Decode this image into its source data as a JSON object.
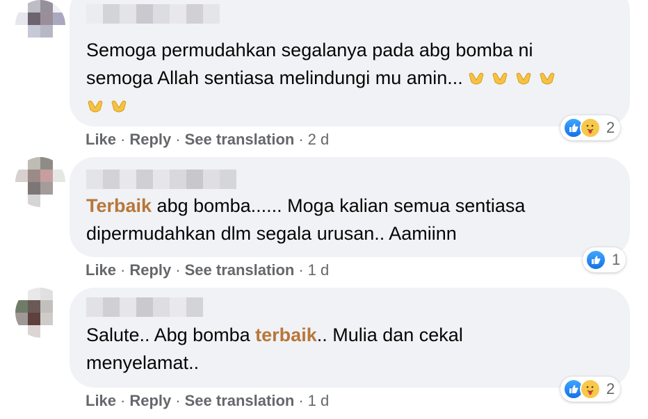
{
  "comments": [
    {
      "text_line1": "Semoga permudahkan segalanya pada abg bomba ni",
      "text_line2": "semoga Allah sentiasa melindungi mu amin...",
      "emoji": "open-hands-emoji",
      "actions": {
        "like": "Like",
        "reply": "Reply",
        "translate": "See translation",
        "time": "2 d"
      },
      "reactions": [
        "like-icon",
        "care-icon"
      ],
      "reaction_count": "2",
      "avatar_colors": [
        "#ffffff",
        "#bdbdc4",
        "#96909a",
        "#f0f0f4",
        "#e6e6ec",
        "#6e6470",
        "#9a8f99",
        "#aaa8c0",
        "#ffffff",
        "#c8c9d6",
        "#b7b7c7",
        "#ffffff",
        "#ffffff",
        "#ffffff",
        "#ffffff",
        "#ffffff"
      ]
    },
    {
      "tag": "Terbaik",
      "text_line1_rest": " abg bomba...... Moga kalian semua sentiasa",
      "text_line2": "dipermudahkan dlm segala urusan.. Aamiinn",
      "actions": {
        "like": "Like",
        "reply": "Reply",
        "translate": "See translation",
        "time": "1 d"
      },
      "reactions": [
        "like-icon"
      ],
      "reaction_count": "1",
      "avatar_colors": [
        "#ffffff",
        "#bfbcb4",
        "#8f8c87",
        "#ffffff",
        "#d8d0cf",
        "#9a8b86",
        "#c79ea0",
        "#e5e7e3",
        "#ffffff",
        "#7d7676",
        "#a59b9b",
        "#ffffff",
        "#ffffff",
        "#d7d4d6",
        "#ffffff",
        "#ffffff"
      ]
    },
    {
      "text_start": "Salute.. Abg bomba ",
      "tag": "terbaik",
      "text_line1_rest": ".. Mulia dan cekal",
      "text_line2": "menyelamat..",
      "actions": {
        "like": "Like",
        "reply": "Reply",
        "translate": "See translation",
        "time": "1 d"
      },
      "reactions": [
        "like-icon",
        "care-icon"
      ],
      "reaction_count": "2",
      "avatar_colors": [
        "#ffffff",
        "#e8e8e8",
        "#e0e0e0",
        "#ffffff",
        "#6f7c68",
        "#6a5a55",
        "#c1c0bc",
        "#ffffff",
        "#9e9896",
        "#5e403d",
        "#cfcbc8",
        "#ffffff",
        "#ffffff",
        "#ddd4d4",
        "#ffffff",
        "#ffffff"
      ]
    }
  ],
  "colors": {
    "bubble": "#f0f2f5",
    "tag": "#b8763a",
    "meta": "#65676b",
    "like_blue": "#1771e6"
  }
}
